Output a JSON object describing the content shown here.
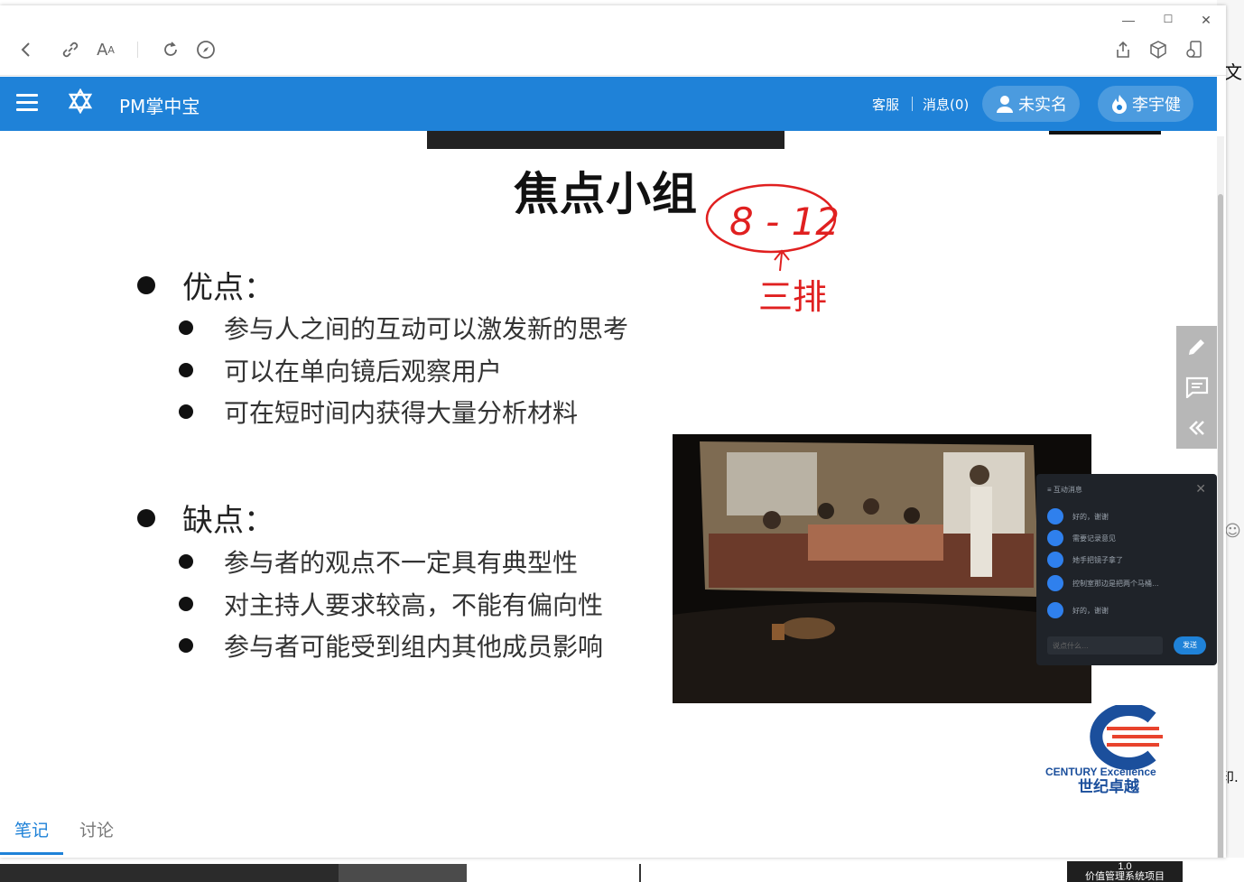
{
  "window_controls": {
    "minimize": "—",
    "maximize": "☐",
    "close": "✕"
  },
  "background": {
    "frag_top": "文",
    "frag_mid": "☺",
    "frag_bottom": "印.",
    "thumb_line1": "1.0",
    "thumb_line2": "价值管理系统项目"
  },
  "appbar": {
    "brand": "PM掌中宝",
    "service": "客服",
    "messages": "消息(0)",
    "verify": "未实名",
    "user": "李宇健"
  },
  "slide": {
    "title": "焦点小组",
    "annotation": "8 - 12",
    "annotation_sub": "三排",
    "pros_heading": "优点：",
    "pros": [
      "参与人之间的互动可以激发新的思考",
      "可以在单向镜后观察用户",
      "可在短时间内获得大量分析材料"
    ],
    "cons_heading": "缺点：",
    "cons": [
      "参与者的观点不一定具有典型性",
      "对主持人要求较高，不能有偏向性",
      "参与者可能受到组内其他成员影响"
    ],
    "chat": {
      "title": "互动消息",
      "messages": [
        "好的，谢谢",
        "需要记录意见",
        "她手把镜子拿了",
        "控制室那边是把两个马桶…",
        "好的，谢谢"
      ],
      "input_placeholder": "说点什么…",
      "send": "发送"
    },
    "logo_text_en": "CENTURY Excellence",
    "logo_text_cn": "世纪卓越"
  },
  "bottom_tabs": {
    "notes": "笔记",
    "discuss": "讨论"
  },
  "colors": {
    "accent": "#1f82d8",
    "annotation": "#e02020"
  }
}
